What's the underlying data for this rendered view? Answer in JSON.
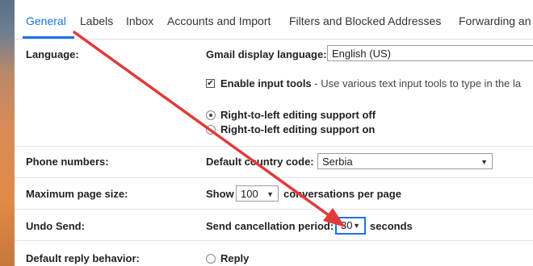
{
  "tabs": [
    {
      "label": "General",
      "active": true
    },
    {
      "label": "Labels"
    },
    {
      "label": "Inbox"
    },
    {
      "label": "Accounts and Import"
    },
    {
      "label": "Filters and Blocked Addresses"
    },
    {
      "label": "Forwarding an"
    }
  ],
  "language": {
    "row_label": "Language:",
    "display_label": "Gmail display language:",
    "display_value": "English (US)",
    "input_tools_label": "Enable input tools",
    "input_tools_checked": true,
    "input_tools_desc": " - Use various text input tools to type in the la",
    "rtl_off": "Right-to-left editing support off",
    "rtl_on": "Right-to-left editing support on",
    "rtl_selected": "off"
  },
  "phone": {
    "row_label": "Phone numbers:",
    "country_label": "Default country code:",
    "country_value": "Serbia"
  },
  "page_size": {
    "row_label": "Maximum page size:",
    "prefix": "Show",
    "value": "100",
    "suffix": "conversations per page"
  },
  "undo_send": {
    "row_label": "Undo Send:",
    "prefix": "Send cancellation period:",
    "value": "30",
    "suffix": "seconds"
  },
  "reply": {
    "row_label": "Default reply behavior:",
    "option": "Reply"
  },
  "colors": {
    "accent": "#1a73e8",
    "annotation_arrow": "#e23a3a"
  }
}
